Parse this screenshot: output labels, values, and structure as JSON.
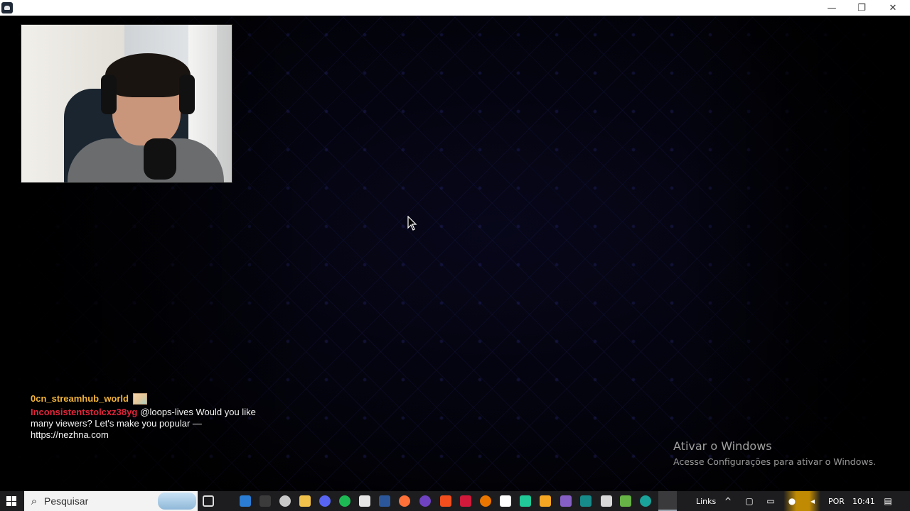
{
  "window": {
    "app_icon": "obs-app-icon",
    "controls": {
      "minimize": "—",
      "restore": "❐",
      "close": "✕"
    }
  },
  "stage": {
    "chat": {
      "username": "0cn_streamhub_world",
      "sender": "Inconsistentstolcxz38yg",
      "message": "@loops-lives Would you like many viewers? Let's make you popular —",
      "url": "https://nezhna.com"
    },
    "watermark": {
      "title": "Ativar o Windows",
      "subtitle": "Acesse Configurações para ativar o Windows."
    }
  },
  "taskbar": {
    "search_placeholder": "Pesquisar",
    "links_label": "Links",
    "language": "POR",
    "time": "10:41",
    "pinned_icons": [
      "task-view-icon",
      "edge-icon",
      "arrow-icon",
      "steam-icon",
      "file-explorer-icon",
      "discord-icon",
      "spotify-icon",
      "notion-icon",
      "word-icon",
      "firefox-icon",
      "obs-studio-icon",
      "figma-icon",
      "app-red-icon",
      "blender-icon",
      "unity-icon",
      "app-green-icon",
      "app-orange-icon",
      "visual-studio-icon",
      "app-teal-icon",
      "app-bird-icon",
      "app-frog-icon",
      "edge-dev-icon",
      "obs-active-icon"
    ],
    "colors": {
      "background": "#1d1d1f",
      "chat_username": "#f0b33d",
      "chat_sender": "#e0263b"
    }
  }
}
